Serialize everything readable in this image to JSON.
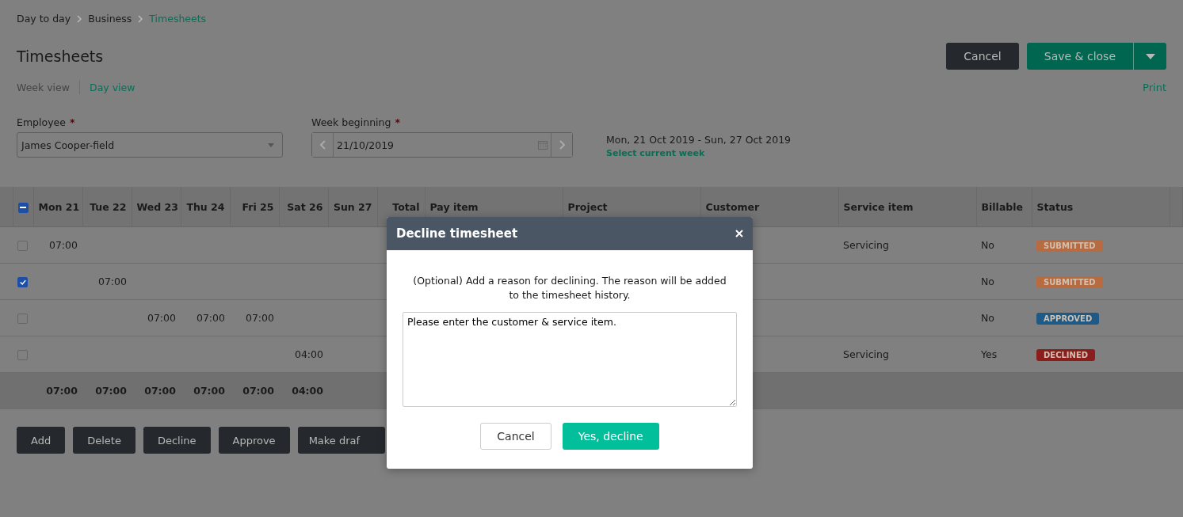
{
  "breadcrumbs": [
    {
      "label": "Day to day",
      "selected": false
    },
    {
      "label": "Business",
      "selected": false
    },
    {
      "label": "Timesheets",
      "selected": true
    }
  ],
  "title": "Timesheets",
  "header_buttons": {
    "cancel": "Cancel",
    "save": "Save & close"
  },
  "view_tabs": [
    {
      "label": "Week view",
      "selected": false
    },
    {
      "label": "Day view",
      "selected": true
    }
  ],
  "print_link": "Print",
  "employee": {
    "label": "Employee",
    "required_mark": "*",
    "value": "James Cooper-field"
  },
  "week_beginning": {
    "label": "Week beginning",
    "required_mark": "*",
    "value": "21/10/2019"
  },
  "date_range": "Mon, 21 Oct 2019 - Sun, 27 Oct 2019",
  "select_current_week": "Select current week",
  "table": {
    "select_all": {
      "indeterminate": true
    },
    "day_columns": [
      "Mon 21",
      "Tue 22",
      "Wed 23",
      "Thu 24",
      "Fri 25",
      "Sat 26",
      "Sun 27"
    ],
    "other_columns": [
      "Total",
      "Pay item",
      "Project",
      "Customer",
      "Service item",
      "Billable",
      "Status"
    ],
    "rows": [
      {
        "checked": false,
        "hours": [
          {
            "kind": "time",
            "text": "07:00"
          },
          {
            "kind": "blank"
          },
          {
            "kind": "blank"
          },
          {
            "kind": "blank"
          },
          {
            "kind": "blank"
          },
          {
            "kind": "blank"
          },
          {
            "kind": "blank"
          }
        ],
        "service_item": "Servicing",
        "billable": "No",
        "status": {
          "label": "SUBMITTED",
          "color": "#b86a40"
        }
      },
      {
        "checked": true,
        "hours": [
          {
            "kind": "blank"
          },
          {
            "kind": "time",
            "text": "07:00"
          },
          {
            "kind": "blank"
          },
          {
            "kind": "blank"
          },
          {
            "kind": "blank"
          },
          {
            "kind": "blank"
          },
          {
            "kind": "blank"
          }
        ],
        "billable": "No",
        "status": {
          "label": "SUBMITTED",
          "color": "#b86a40"
        }
      },
      {
        "checked": false,
        "hours": [
          {
            "kind": "blank"
          },
          {
            "kind": "blank"
          },
          {
            "kind": "time",
            "text": "07:00"
          },
          {
            "kind": "time",
            "text": "07:00"
          },
          {
            "kind": "time",
            "text": "07:00"
          },
          {
            "kind": "blank"
          },
          {
            "kind": "blank"
          }
        ],
        "billable": "No",
        "status": {
          "label": "APPROVED",
          "color": "#1e5a85"
        }
      },
      {
        "checked": false,
        "hours": [
          {
            "kind": "blank"
          },
          {
            "kind": "blank"
          },
          {
            "kind": "blank"
          },
          {
            "kind": "blank"
          },
          {
            "kind": "blank"
          },
          {
            "kind": "time",
            "text": "04:00"
          },
          {
            "kind": "blank"
          }
        ],
        "service_item": "Servicing",
        "billable": "Yes",
        "status": {
          "label": "DECLINED",
          "color": "#8c1d1d"
        }
      }
    ],
    "totals": [
      "07:00",
      "07:00",
      "07:00",
      "07:00",
      "07:00",
      "04:00"
    ]
  },
  "action_buttons": [
    "Add",
    "Delete",
    "Decline",
    "Approve",
    "Make draf"
  ],
  "dialog": {
    "title": "Decline timesheet",
    "message": "(Optional) Add a reason for declining. The reason will be added to the timesheet history.",
    "reason": "Please enter the customer & service item.",
    "cancel": "Cancel",
    "confirm": "Yes, decline"
  }
}
